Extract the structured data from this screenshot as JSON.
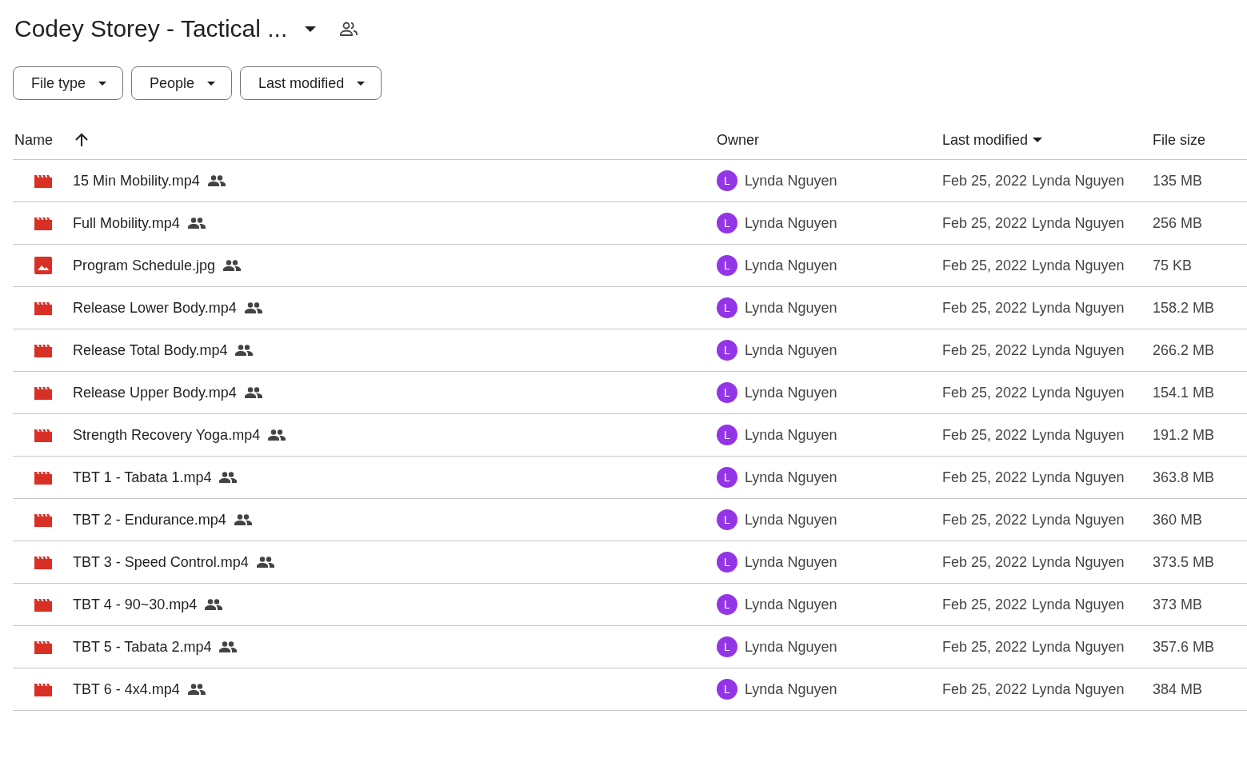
{
  "folder": {
    "title": "Codey Storey - Tactical ..."
  },
  "filters": [
    {
      "label": "File type"
    },
    {
      "label": "People"
    },
    {
      "label": "Last modified"
    }
  ],
  "columns": {
    "name": "Name",
    "owner": "Owner",
    "modified": "Last modified",
    "size": "File size"
  },
  "rows": [
    {
      "kind": "video",
      "name": "15 Min Mobility.mp4",
      "owner_initial": "L",
      "owner": "Lynda Nguyen",
      "date": "Feb 25, 2022",
      "modified_by": "Lynda Nguyen",
      "size": "135 MB"
    },
    {
      "kind": "video",
      "name": "Full Mobility.mp4",
      "owner_initial": "L",
      "owner": "Lynda Nguyen",
      "date": "Feb 25, 2022",
      "modified_by": "Lynda Nguyen",
      "size": "256 MB"
    },
    {
      "kind": "image",
      "name": "Program Schedule.jpg",
      "owner_initial": "L",
      "owner": "Lynda Nguyen",
      "date": "Feb 25, 2022",
      "modified_by": "Lynda Nguyen",
      "size": "75 KB"
    },
    {
      "kind": "video",
      "name": "Release Lower Body.mp4",
      "owner_initial": "L",
      "owner": "Lynda Nguyen",
      "date": "Feb 25, 2022",
      "modified_by": "Lynda Nguyen",
      "size": "158.2 MB"
    },
    {
      "kind": "video",
      "name": "Release Total Body.mp4",
      "owner_initial": "L",
      "owner": "Lynda Nguyen",
      "date": "Feb 25, 2022",
      "modified_by": "Lynda Nguyen",
      "size": "266.2 MB"
    },
    {
      "kind": "video",
      "name": "Release Upper Body.mp4",
      "owner_initial": "L",
      "owner": "Lynda Nguyen",
      "date": "Feb 25, 2022",
      "modified_by": "Lynda Nguyen",
      "size": "154.1 MB"
    },
    {
      "kind": "video",
      "name": "Strength Recovery Yoga.mp4",
      "owner_initial": "L",
      "owner": "Lynda Nguyen",
      "date": "Feb 25, 2022",
      "modified_by": "Lynda Nguyen",
      "size": "191.2 MB"
    },
    {
      "kind": "video",
      "name": "TBT 1 - Tabata 1.mp4",
      "owner_initial": "L",
      "owner": "Lynda Nguyen",
      "date": "Feb 25, 2022",
      "modified_by": "Lynda Nguyen",
      "size": "363.8 MB"
    },
    {
      "kind": "video",
      "name": "TBT 2 - Endurance.mp4",
      "owner_initial": "L",
      "owner": "Lynda Nguyen",
      "date": "Feb 25, 2022",
      "modified_by": "Lynda Nguyen",
      "size": "360 MB"
    },
    {
      "kind": "video",
      "name": "TBT 3 - Speed Control.mp4",
      "owner_initial": "L",
      "owner": "Lynda Nguyen",
      "date": "Feb 25, 2022",
      "modified_by": "Lynda Nguyen",
      "size": "373.5 MB"
    },
    {
      "kind": "video",
      "name": "TBT 4 - 90~30.mp4",
      "owner_initial": "L",
      "owner": "Lynda Nguyen",
      "date": "Feb 25, 2022",
      "modified_by": "Lynda Nguyen",
      "size": "373 MB"
    },
    {
      "kind": "video",
      "name": "TBT 5 - Tabata 2.mp4",
      "owner_initial": "L",
      "owner": "Lynda Nguyen",
      "date": "Feb 25, 2022",
      "modified_by": "Lynda Nguyen",
      "size": "357.6 MB"
    },
    {
      "kind": "video",
      "name": "TBT 6 - 4x4.mp4",
      "owner_initial": "L",
      "owner": "Lynda Nguyen",
      "date": "Feb 25, 2022",
      "modified_by": "Lynda Nguyen",
      "size": "384 MB"
    }
  ]
}
